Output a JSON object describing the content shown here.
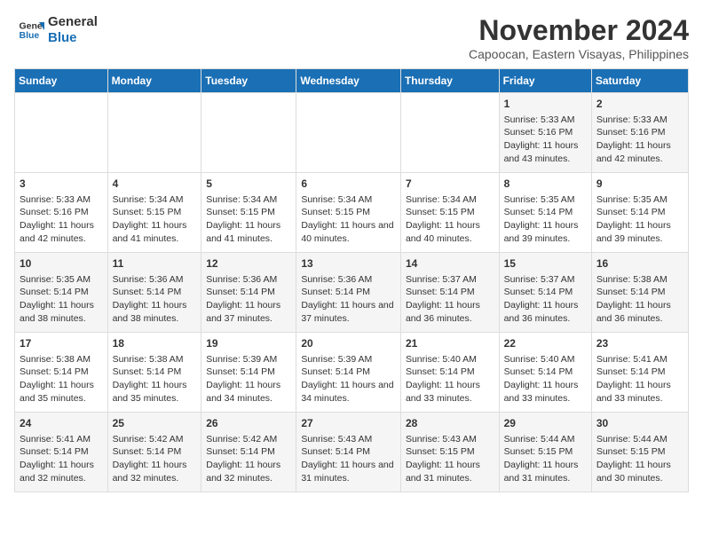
{
  "logo": {
    "line1": "General",
    "line2": "Blue"
  },
  "title": "November 2024",
  "subtitle": "Capoocan, Eastern Visayas, Philippines",
  "days_header": [
    "Sunday",
    "Monday",
    "Tuesday",
    "Wednesday",
    "Thursday",
    "Friday",
    "Saturday"
  ],
  "weeks": [
    [
      {
        "day": "",
        "info": ""
      },
      {
        "day": "",
        "info": ""
      },
      {
        "day": "",
        "info": ""
      },
      {
        "day": "",
        "info": ""
      },
      {
        "day": "",
        "info": ""
      },
      {
        "day": "1",
        "info": "Sunrise: 5:33 AM\nSunset: 5:16 PM\nDaylight: 11 hours and 43 minutes."
      },
      {
        "day": "2",
        "info": "Sunrise: 5:33 AM\nSunset: 5:16 PM\nDaylight: 11 hours and 42 minutes."
      }
    ],
    [
      {
        "day": "3",
        "info": "Sunrise: 5:33 AM\nSunset: 5:16 PM\nDaylight: 11 hours and 42 minutes."
      },
      {
        "day": "4",
        "info": "Sunrise: 5:34 AM\nSunset: 5:15 PM\nDaylight: 11 hours and 41 minutes."
      },
      {
        "day": "5",
        "info": "Sunrise: 5:34 AM\nSunset: 5:15 PM\nDaylight: 11 hours and 41 minutes."
      },
      {
        "day": "6",
        "info": "Sunrise: 5:34 AM\nSunset: 5:15 PM\nDaylight: 11 hours and 40 minutes."
      },
      {
        "day": "7",
        "info": "Sunrise: 5:34 AM\nSunset: 5:15 PM\nDaylight: 11 hours and 40 minutes."
      },
      {
        "day": "8",
        "info": "Sunrise: 5:35 AM\nSunset: 5:14 PM\nDaylight: 11 hours and 39 minutes."
      },
      {
        "day": "9",
        "info": "Sunrise: 5:35 AM\nSunset: 5:14 PM\nDaylight: 11 hours and 39 minutes."
      }
    ],
    [
      {
        "day": "10",
        "info": "Sunrise: 5:35 AM\nSunset: 5:14 PM\nDaylight: 11 hours and 38 minutes."
      },
      {
        "day": "11",
        "info": "Sunrise: 5:36 AM\nSunset: 5:14 PM\nDaylight: 11 hours and 38 minutes."
      },
      {
        "day": "12",
        "info": "Sunrise: 5:36 AM\nSunset: 5:14 PM\nDaylight: 11 hours and 37 minutes."
      },
      {
        "day": "13",
        "info": "Sunrise: 5:36 AM\nSunset: 5:14 PM\nDaylight: 11 hours and 37 minutes."
      },
      {
        "day": "14",
        "info": "Sunrise: 5:37 AM\nSunset: 5:14 PM\nDaylight: 11 hours and 36 minutes."
      },
      {
        "day": "15",
        "info": "Sunrise: 5:37 AM\nSunset: 5:14 PM\nDaylight: 11 hours and 36 minutes."
      },
      {
        "day": "16",
        "info": "Sunrise: 5:38 AM\nSunset: 5:14 PM\nDaylight: 11 hours and 36 minutes."
      }
    ],
    [
      {
        "day": "17",
        "info": "Sunrise: 5:38 AM\nSunset: 5:14 PM\nDaylight: 11 hours and 35 minutes."
      },
      {
        "day": "18",
        "info": "Sunrise: 5:38 AM\nSunset: 5:14 PM\nDaylight: 11 hours and 35 minutes."
      },
      {
        "day": "19",
        "info": "Sunrise: 5:39 AM\nSunset: 5:14 PM\nDaylight: 11 hours and 34 minutes."
      },
      {
        "day": "20",
        "info": "Sunrise: 5:39 AM\nSunset: 5:14 PM\nDaylight: 11 hours and 34 minutes."
      },
      {
        "day": "21",
        "info": "Sunrise: 5:40 AM\nSunset: 5:14 PM\nDaylight: 11 hours and 33 minutes."
      },
      {
        "day": "22",
        "info": "Sunrise: 5:40 AM\nSunset: 5:14 PM\nDaylight: 11 hours and 33 minutes."
      },
      {
        "day": "23",
        "info": "Sunrise: 5:41 AM\nSunset: 5:14 PM\nDaylight: 11 hours and 33 minutes."
      }
    ],
    [
      {
        "day": "24",
        "info": "Sunrise: 5:41 AM\nSunset: 5:14 PM\nDaylight: 11 hours and 32 minutes."
      },
      {
        "day": "25",
        "info": "Sunrise: 5:42 AM\nSunset: 5:14 PM\nDaylight: 11 hours and 32 minutes."
      },
      {
        "day": "26",
        "info": "Sunrise: 5:42 AM\nSunset: 5:14 PM\nDaylight: 11 hours and 32 minutes."
      },
      {
        "day": "27",
        "info": "Sunrise: 5:43 AM\nSunset: 5:14 PM\nDaylight: 11 hours and 31 minutes."
      },
      {
        "day": "28",
        "info": "Sunrise: 5:43 AM\nSunset: 5:15 PM\nDaylight: 11 hours and 31 minutes."
      },
      {
        "day": "29",
        "info": "Sunrise: 5:44 AM\nSunset: 5:15 PM\nDaylight: 11 hours and 31 minutes."
      },
      {
        "day": "30",
        "info": "Sunrise: 5:44 AM\nSunset: 5:15 PM\nDaylight: 11 hours and 30 minutes."
      }
    ]
  ]
}
